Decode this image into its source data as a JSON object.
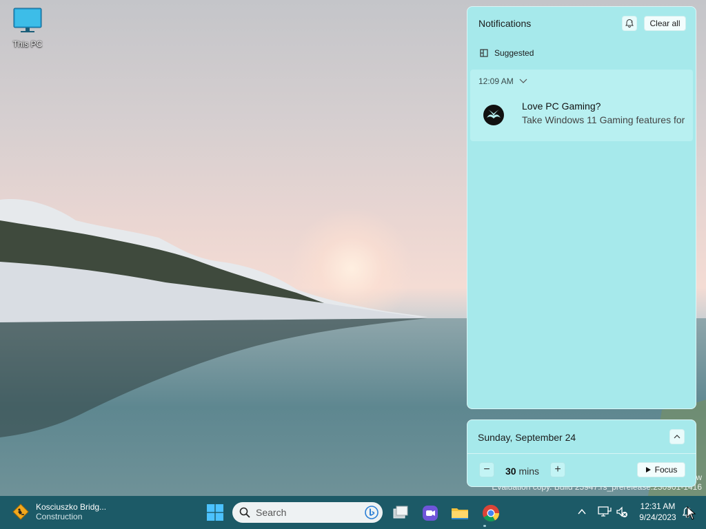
{
  "desktop": {
    "icons": [
      {
        "label": "This PC",
        "icon": "computer-icon"
      }
    ],
    "watermark": {
      "line1": "w",
      "line2": "Evaluation copy. Build 25947.rs_prerelease.230901-1416"
    }
  },
  "notifications": {
    "title": "Notifications",
    "clear_all_label": "Clear all",
    "settings_icon": "do-not-disturb-icon",
    "section_label": "Suggested",
    "items": [
      {
        "time": "12:09 AM",
        "app_icon": "xbox-icon",
        "title": "Love PC Gaming?",
        "body": "Take Windows 11 Gaming features for"
      }
    ]
  },
  "calendar": {
    "date_label": "Sunday, September 24",
    "focus": {
      "minutes": "30",
      "unit": "mins",
      "minus_label": "−",
      "plus_label": "+",
      "button_label": "Focus"
    }
  },
  "taskbar": {
    "weather": {
      "title": "Kosciuszko Bridg...",
      "subtitle": "Construction"
    },
    "search_placeholder": "Search",
    "apps": [
      "task-view",
      "teams",
      "file-explorer",
      "chrome"
    ],
    "clock": {
      "time": "12:31 AM",
      "date": "9/24/2023"
    }
  },
  "colors": {
    "panel_bg": "#a6e9eb",
    "taskbar_bg": "#1c5a67",
    "card_bg": "#b8f0f1"
  }
}
